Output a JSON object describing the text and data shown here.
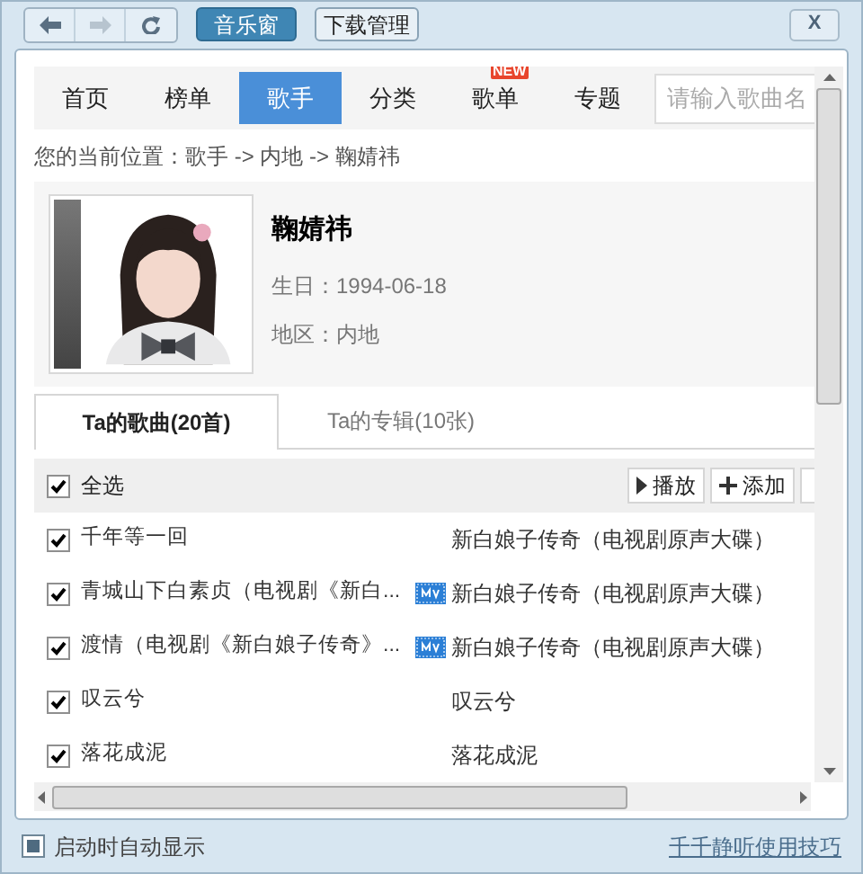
{
  "toolbar": {
    "nav_buttons": [
      {
        "kind": "back",
        "disabled": false
      },
      {
        "kind": "forward",
        "disabled": true
      },
      {
        "kind": "refresh",
        "disabled": false
      }
    ],
    "tabs": [
      {
        "label": "音乐窗",
        "selected": true
      },
      {
        "label": "下载管理",
        "selected": false
      }
    ],
    "close": "X"
  },
  "nav": {
    "items": [
      {
        "label": "首页",
        "selected": false
      },
      {
        "label": "榜单",
        "selected": false
      },
      {
        "label": "歌手",
        "selected": true
      },
      {
        "label": "分类",
        "selected": false
      },
      {
        "label": "歌单",
        "selected": false,
        "badge": "NEW"
      },
      {
        "label": "专题",
        "selected": false
      }
    ],
    "search": {
      "placeholder": "请输入歌曲名"
    }
  },
  "breadcrumb": "您的当前位置：歌手 -> 内地 -> 鞠婧祎",
  "artist": {
    "name": "鞠婧祎",
    "fields": [
      {
        "label": "生日：",
        "value": "1994-06-18"
      },
      {
        "label": "地区：",
        "value": "内地"
      }
    ]
  },
  "content_tabs": [
    {
      "label": "Ta的歌曲(20首)",
      "selected": true
    },
    {
      "label": "Ta的专辑(10张)",
      "selected": false
    }
  ],
  "select_all": {
    "label": "全选",
    "checked": true
  },
  "actions": [
    {
      "kind": "play",
      "label": "播放"
    },
    {
      "kind": "add",
      "label": "添加"
    }
  ],
  "songs": [
    {
      "title": "千年等一回",
      "mv": false,
      "album": "新白娘子传奇（电视剧原声大碟）",
      "checked": true
    },
    {
      "title": "青城山下白素贞（电视剧《新白...",
      "mv": true,
      "album": "新白娘子传奇（电视剧原声大碟）",
      "checked": true
    },
    {
      "title": "渡情（电视剧《新白娘子传奇》...",
      "mv": true,
      "album": "新白娘子传奇（电视剧原声大碟）",
      "checked": true
    },
    {
      "title": "叹云兮",
      "mv": false,
      "album": "叹云兮",
      "checked": true
    },
    {
      "title": "落花成泥",
      "mv": false,
      "album": "落花成泥",
      "checked": true
    }
  ],
  "footer": {
    "autostart": {
      "label": "启动时自动显示",
      "checked": true
    },
    "link": "千千静听使用技巧"
  }
}
